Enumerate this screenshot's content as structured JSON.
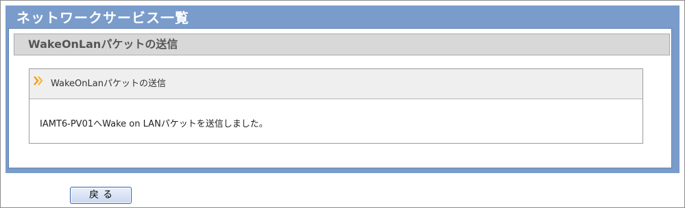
{
  "page": {
    "title": "ネットワークサービス一覧"
  },
  "section": {
    "title": "WakeOnLanパケットの送信"
  },
  "panel": {
    "title": "WakeOnLanパケットの送信",
    "icon": "double-chevron-right-icon",
    "icon_color": "#f39c12",
    "message": "IAMT6-PV01へWake on LANパケットを送信しました。"
  },
  "actions": {
    "back_label": "戻る"
  },
  "colors": {
    "header_blue": "#7a9ccb",
    "section_gray": "#d8d8d8"
  }
}
